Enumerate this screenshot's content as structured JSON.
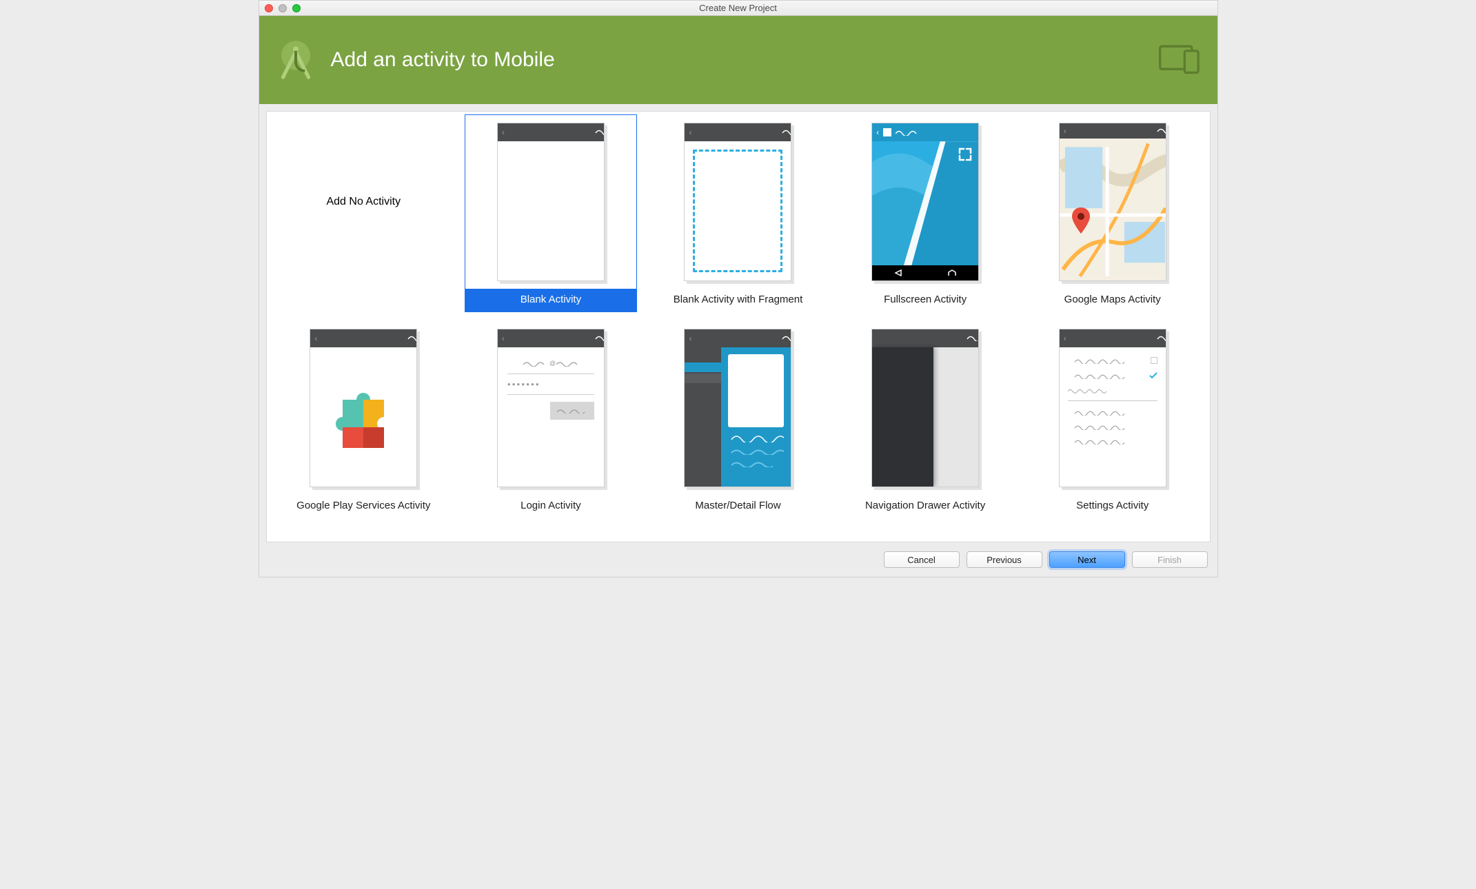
{
  "window_title": "Create New Project",
  "header_title": "Add an activity to Mobile",
  "activities": [
    {
      "label": "Add No Activity",
      "type": "none"
    },
    {
      "label": "Blank Activity",
      "type": "blank",
      "selected": true
    },
    {
      "label": "Blank Activity with Fragment",
      "type": "fragment"
    },
    {
      "label": "Fullscreen Activity",
      "type": "fullscreen"
    },
    {
      "label": "Google Maps Activity",
      "type": "maps"
    },
    {
      "label": "Google Play Services Activity",
      "type": "play"
    },
    {
      "label": "Login Activity",
      "type": "login"
    },
    {
      "label": "Master/Detail Flow",
      "type": "masterdetail"
    },
    {
      "label": "Navigation Drawer Activity",
      "type": "navdrawer"
    },
    {
      "label": "Settings Activity",
      "type": "settings"
    }
  ],
  "buttons": {
    "cancel": "Cancel",
    "previous": "Previous",
    "next": "Next",
    "finish": "Finish"
  }
}
